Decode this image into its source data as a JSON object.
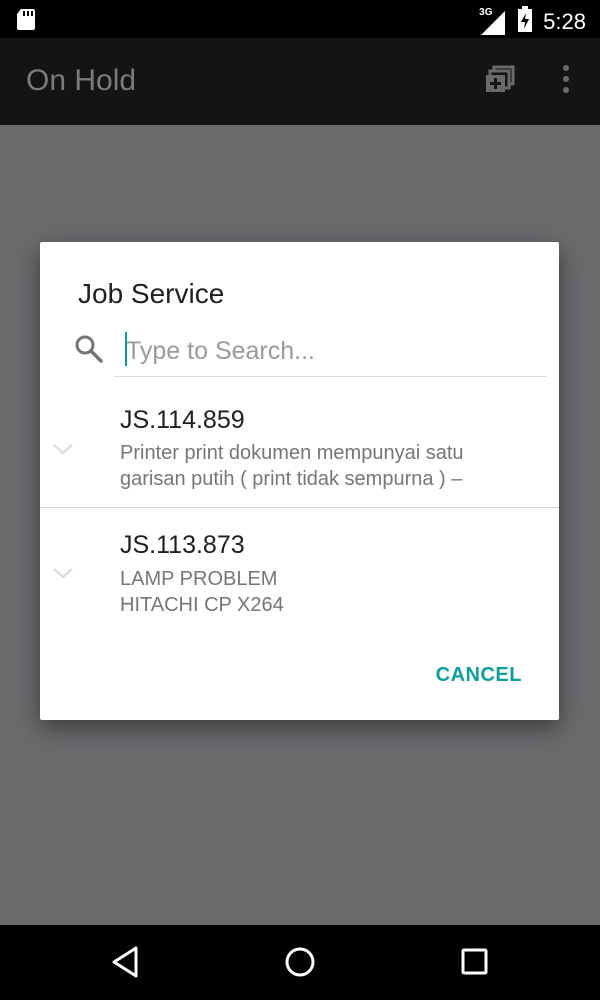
{
  "status_bar": {
    "network": "3G",
    "time": "5:28"
  },
  "app_bar": {
    "title": "On Hold"
  },
  "dialog": {
    "title": "Job Service",
    "search": {
      "placeholder": "Type to Search...",
      "value": ""
    },
    "items": [
      {
        "code": "JS.114.859",
        "desc_line1": "Printer print dokumen mempunyai satu",
        "desc_line2": "garisan putih ( print tidak sempurna ) –"
      },
      {
        "code": "JS.113.873",
        "desc_line1": "LAMP PROBLEM",
        "desc_line2": "HITACHI CP X264"
      }
    ],
    "cancel_label": "CANCEL"
  },
  "colors": {
    "accent": "#0f9e99",
    "status_bar": "#000000",
    "app_bar": "#141414",
    "scrim": "#6b6a6d"
  },
  "icons": [
    "sd-card-icon",
    "signal-icon",
    "battery-icon",
    "add-multiple-icon",
    "overflow-menu-icon",
    "search-icon",
    "chevron-down-icon",
    "back-icon",
    "home-icon",
    "recents-icon"
  ]
}
